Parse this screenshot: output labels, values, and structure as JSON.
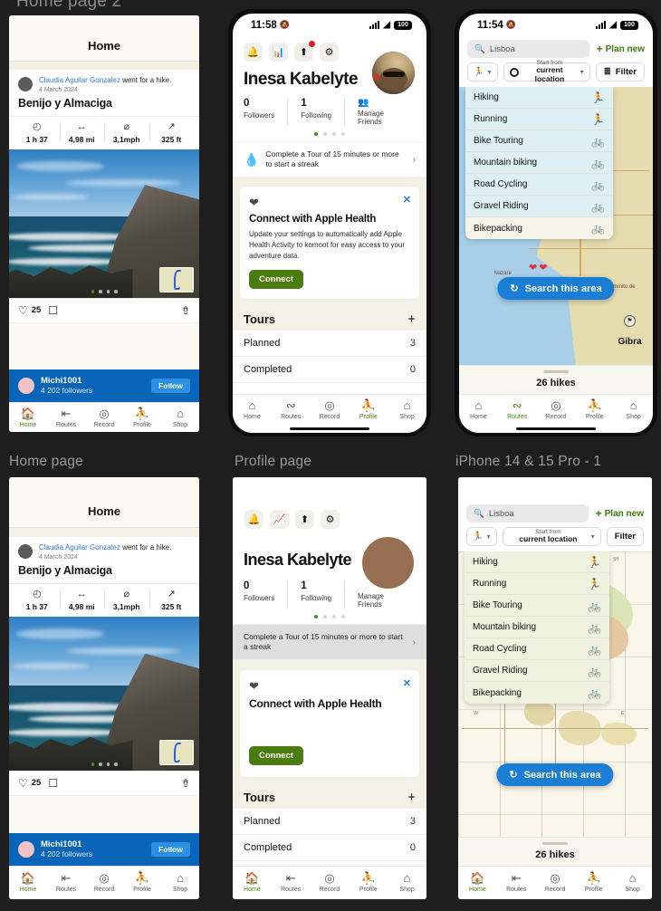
{
  "page": {
    "background": "#1e1e1e",
    "cut_label": "Home page 2"
  },
  "captions": {
    "home": "Home page",
    "profile": "Profile page",
    "map": "iPhone 14 & 15 Pro - 1"
  },
  "status_bar": {
    "time_home": "11:58",
    "time_map": "11:54",
    "battery": "100",
    "mute_icon": "bell-slash-icon",
    "signal_icon": "cellular-signal-icon",
    "wifi_icon": "wifi-icon"
  },
  "home_page": {
    "header_title": "Home",
    "post": {
      "author": "Claudia Aguilar Gonzalez",
      "action": " went for a hike.",
      "date": "4 March  2024",
      "title": "Benijo y Almaciga",
      "stats": [
        {
          "icon": "clock-icon",
          "glyph": "◴",
          "value": "1 h 37"
        },
        {
          "icon": "distance-icon",
          "glyph": "↔",
          "value": "4,98 mi"
        },
        {
          "icon": "speed-icon",
          "glyph": "⌀",
          "value": "3,1mph"
        },
        {
          "icon": "elevation-icon",
          "glyph": "↗",
          "value": "325 ft"
        }
      ],
      "photo_dots": 4,
      "photo_active_dot": 0,
      "like_icon": "heart-outline-icon",
      "like_count": "25",
      "comment_icon": "comment-icon",
      "share_icon": "share-icon"
    },
    "follow_bar": {
      "name": "Michi1001",
      "followers": "4 202 followers",
      "button": "Follow",
      "color": "#0a64b8"
    }
  },
  "profile_page": {
    "toolbar": [
      {
        "name": "notifications-icon",
        "glyph": "🔔"
      },
      {
        "name": "stats-icon",
        "glyph": "▆"
      },
      {
        "name": "share-icon",
        "glyph": "↑",
        "badge": true
      },
      {
        "name": "settings-gear-icon",
        "glyph": "⚙"
      }
    ],
    "user_name": "Inesa Kabelyte",
    "stats": [
      {
        "num": "0",
        "label": "Followers"
      },
      {
        "num": "1",
        "label": "Following"
      },
      {
        "icon": "friends-icon",
        "label": "Manage Friends"
      }
    ],
    "carousel_dots": 4,
    "carousel_active": 0,
    "streak": {
      "icon": "flame-icon",
      "text": "Complete a Tour of 15 minutes or more to start a streak",
      "chevron": "›"
    },
    "health_card": {
      "icon": "heart-filled-icon",
      "close": "✕",
      "title": "Connect with Apple Health",
      "body": "Update your settings to automatically add Apple Health Activity to komoot for easy access to your adventure data.",
      "cta": "Connect",
      "cta_color": "#4b7c0f"
    },
    "tours": {
      "heading": "Tours",
      "add": "+",
      "rows": [
        {
          "label": "Planned",
          "value": "3"
        },
        {
          "label": "Completed",
          "value": "0"
        }
      ]
    }
  },
  "map_page": {
    "search_value": "Lisboa",
    "search_icon": "search-icon",
    "plan_new": "Plan new",
    "plan_new_icon": "plus-icon",
    "sport_selector_icon": "hiking-icon",
    "start_from_line1": "Start from",
    "start_from_line2": "current location",
    "filter_label": "Filter",
    "filter_icon": "sliders-icon",
    "sport_menu": [
      {
        "label": "Hiking",
        "icon": "hiking-icon",
        "glyph": "🚶"
      },
      {
        "label": "Running",
        "icon": "running-icon",
        "glyph": "🏃"
      },
      {
        "label": "Bike Touring",
        "icon": "bike-icon",
        "glyph": "🚲"
      },
      {
        "label": "Mountain biking",
        "icon": "mountain-bike-icon",
        "glyph": "🚵"
      },
      {
        "label": "Road Cycling",
        "icon": "road-bike-icon",
        "glyph": "🚲"
      },
      {
        "label": "Gravel Riding",
        "icon": "gravel-bike-icon",
        "glyph": "🚲"
      },
      {
        "label": "Bikepacking",
        "icon": "bikepacking-icon",
        "glyph": "🚲"
      }
    ],
    "search_this_area": "Search this area",
    "search_this_area_icon": "refresh-icon",
    "search_this_area_color": "#1a7fd4",
    "map_labels": [
      "Nazare",
      "Caminito de",
      "Gibra"
    ],
    "sheet_count": "26 hikes"
  },
  "tab_bar": {
    "items": [
      {
        "label": "Home",
        "icon": "home-icon",
        "glyph": "⌂"
      },
      {
        "label": "Routes",
        "icon": "routes-icon",
        "glyph": "⑂"
      },
      {
        "label": "Record",
        "icon": "record-icon",
        "glyph": "◎"
      },
      {
        "label": "Profile",
        "icon": "profile-icon",
        "glyph": "⚹"
      },
      {
        "label": "Shop",
        "icon": "shop-icon",
        "glyph": "☐"
      }
    ],
    "active_home": 0,
    "active_profile": 3,
    "active_map": 1,
    "active_color": "#4a8a10"
  }
}
